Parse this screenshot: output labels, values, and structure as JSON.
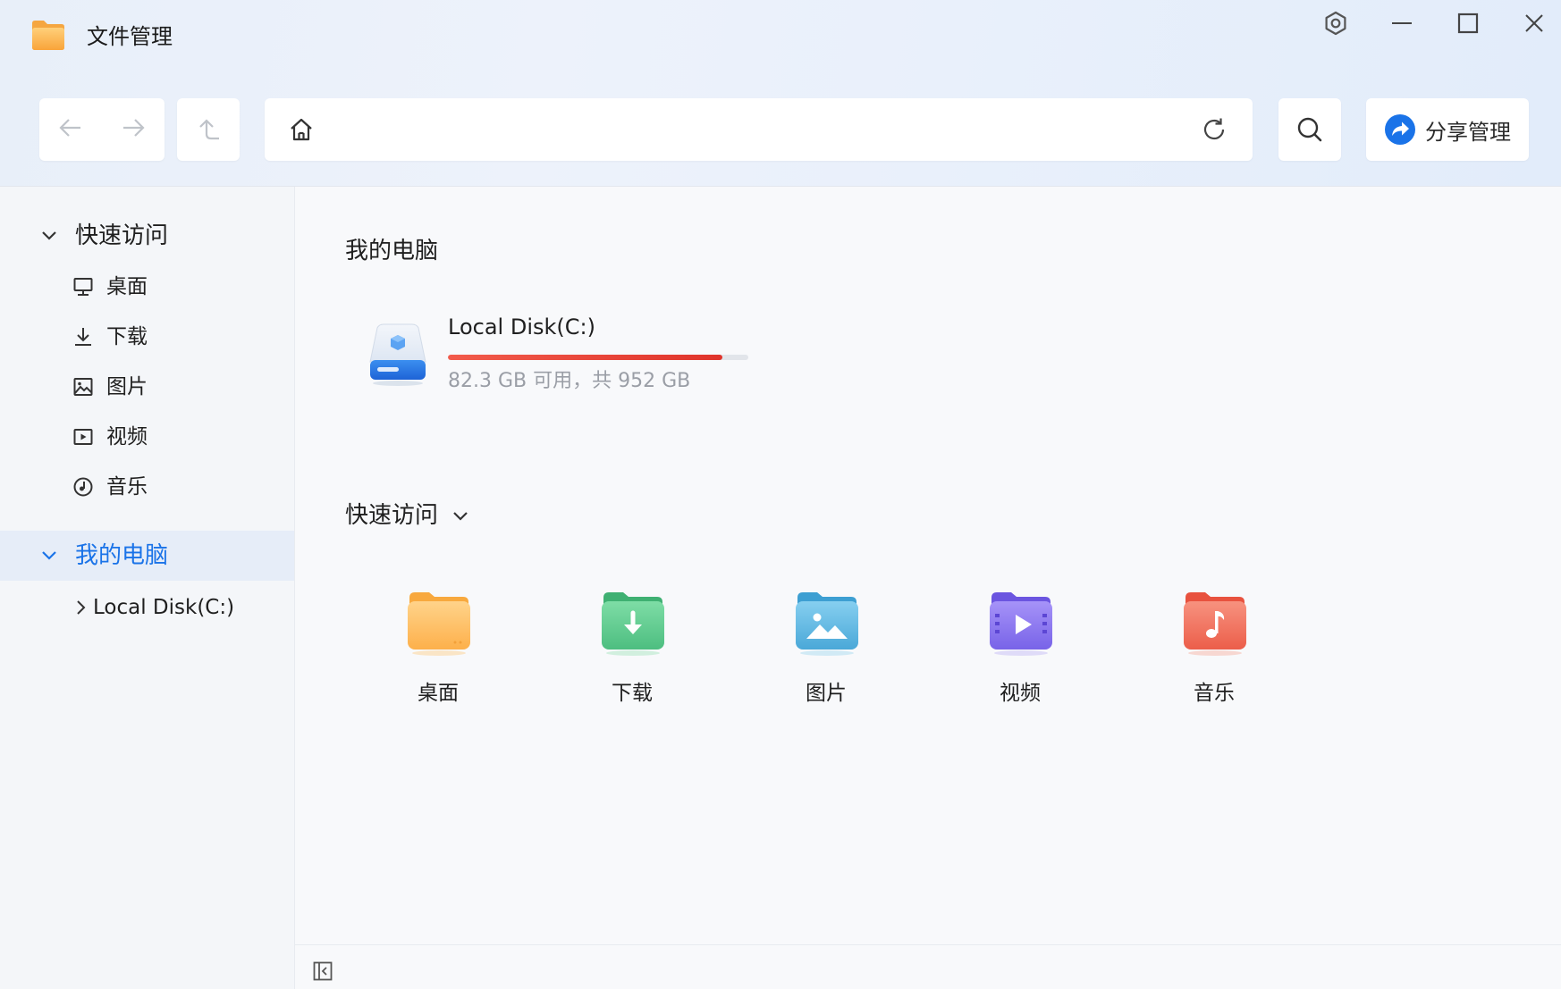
{
  "window": {
    "title": "文件管理"
  },
  "toolbar": {
    "share_label": "分享管理"
  },
  "sidebar": {
    "quick_access": {
      "label": "快速访问",
      "items": [
        {
          "label": "桌面",
          "icon": "monitor-icon"
        },
        {
          "label": "下载",
          "icon": "download-icon"
        },
        {
          "label": "图片",
          "icon": "image-icon"
        },
        {
          "label": "视频",
          "icon": "video-icon"
        },
        {
          "label": "音乐",
          "icon": "music-icon"
        }
      ]
    },
    "my_computer": {
      "label": "我的电脑",
      "active": true,
      "children": [
        {
          "label": "Local Disk(C:)"
        }
      ]
    }
  },
  "main": {
    "my_computer_title": "我的电脑",
    "disk": {
      "name": "Local Disk(C:)",
      "free_text": "82.3 GB 可用，共 952 GB",
      "used_fraction": 0.914
    },
    "quick_access_title": "快速访问",
    "quick_access_items": [
      {
        "label": "桌面",
        "icon": "desktop-folder-icon",
        "color": "#fdbb57"
      },
      {
        "label": "下载",
        "icon": "download-folder-icon",
        "color": "#5fcf91"
      },
      {
        "label": "图片",
        "icon": "pictures-folder-icon",
        "color": "#5fb7e0"
      },
      {
        "label": "视频",
        "icon": "videos-folder-icon",
        "color": "#8a77ee"
      },
      {
        "label": "音乐",
        "icon": "music-folder-icon",
        "color": "#f26a55"
      }
    ]
  },
  "colors": {
    "accent": "#1a73e8",
    "disk_bar": "#e0342b"
  }
}
